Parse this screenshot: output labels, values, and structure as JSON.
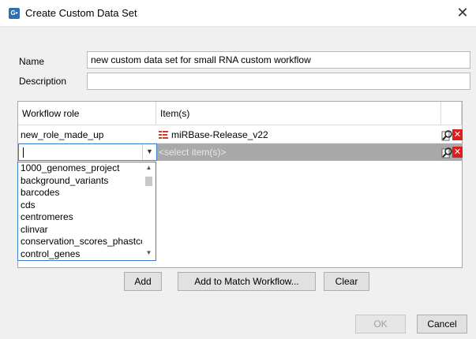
{
  "window": {
    "title": "Create Custom Data Set",
    "icon_text": "G•"
  },
  "form": {
    "name_label": "Name",
    "name_value": "new custom data set for small RNA custom workflow",
    "description_label": "Description",
    "description_value": ""
  },
  "table": {
    "col_role": "Workflow role",
    "col_items": "Item(s)",
    "rows": [
      {
        "role": "new_role_made_up",
        "item": "miRBase-Release_v22"
      },
      {
        "role": "",
        "item": "<select item(s)>"
      }
    ]
  },
  "dropdown": {
    "options": [
      "1000_genomes_project",
      "background_variants",
      "barcodes",
      "cds",
      "centromeres",
      "clinvar",
      "conservation_scores_phastcons",
      "control_genes"
    ]
  },
  "buttons": {
    "add": "Add",
    "add_to_match": "Add to Match Workflow...",
    "clear": "Clear",
    "ok": "OK",
    "cancel": "Cancel"
  },
  "colors": {
    "accent": "#3c7fd1",
    "delete": "#e21b1b",
    "reference": "#d23a2a"
  }
}
